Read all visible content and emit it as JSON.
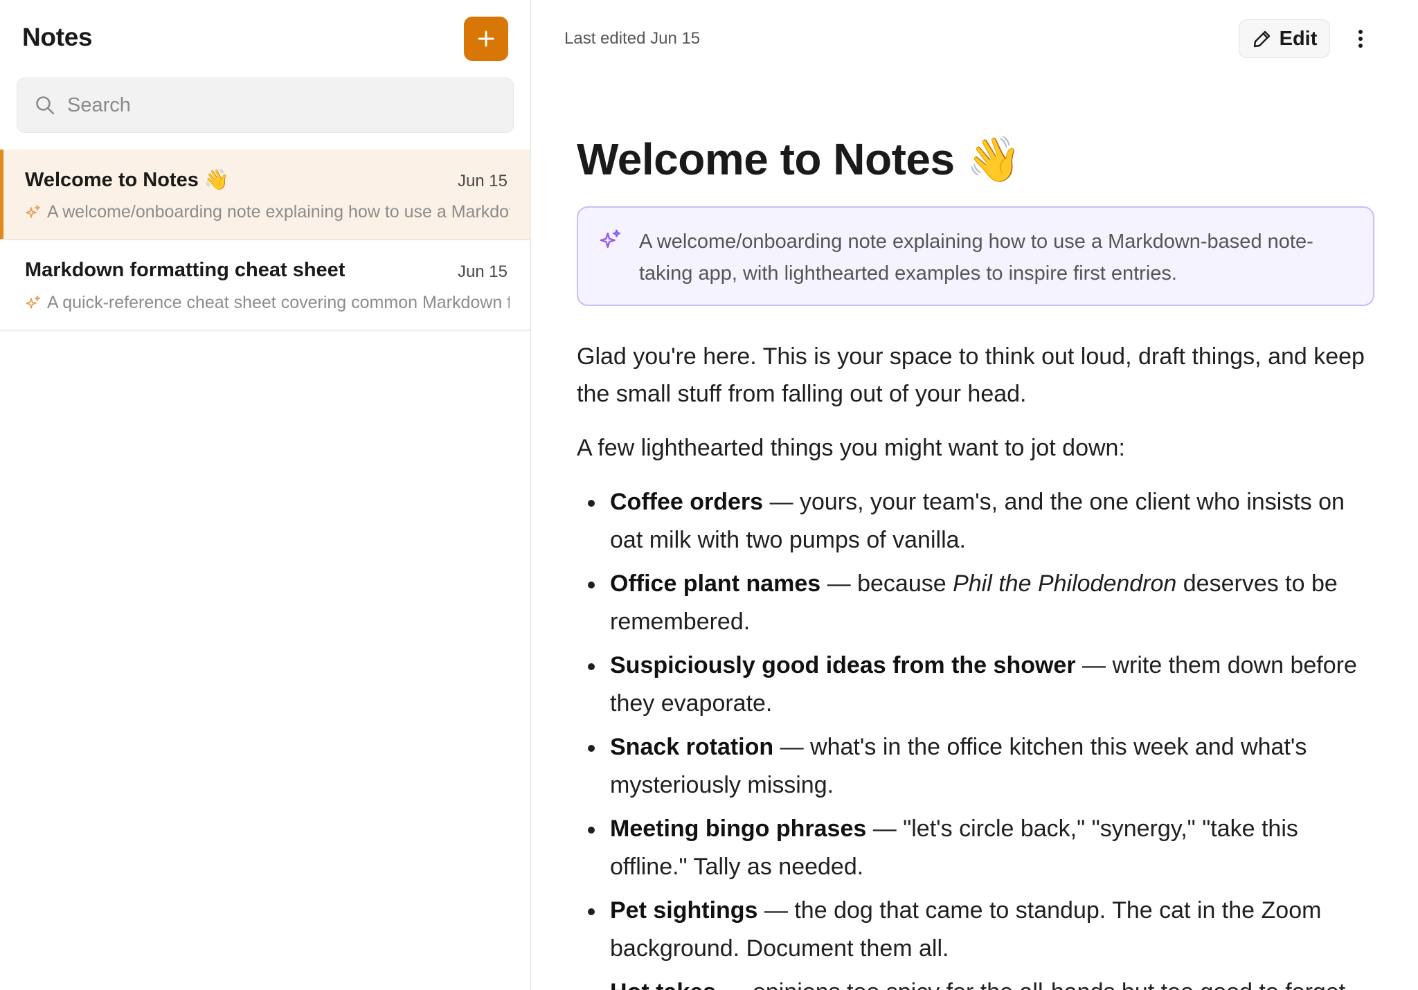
{
  "sidebar": {
    "title": "Notes",
    "search_placeholder": "Search",
    "notes": [
      {
        "title": "Welcome to Notes 👋",
        "date": "Jun 15",
        "summary": "A welcome/onboarding note explaining how to use a Markdown-based note-taking app, with lighthearted examples to inspire first entries.",
        "active": true
      },
      {
        "title": "Markdown formatting cheat sheet",
        "date": "Jun 15",
        "summary": "A quick-reference cheat sheet covering common Markdown formatting syntax.",
        "active": false
      }
    ]
  },
  "header": {
    "last_edited": "Last edited Jun 15",
    "edit_label": "Edit"
  },
  "document": {
    "title": "Welcome to Notes 👋",
    "summary": "A welcome/onboarding note explaining how to use a Markdown-based note-taking app, with lighthearted examples to inspire first entries.",
    "intro": "Glad you're here. This is your space to think out loud, draft things, and keep the small stuff from falling out of your head.",
    "list_lead": "A few lighthearted things you might want to jot down:",
    "items": [
      {
        "bold": "Coffee orders",
        "text": " — yours, your team's, and the one client who insists on oat milk with two pumps of vanilla."
      },
      {
        "bold": "Office plant names",
        "pre": " — because ",
        "italic": "Phil the Philodendron",
        "text": " deserves to be remembered."
      },
      {
        "bold": "Suspiciously good ideas from the shower",
        "text": " — write them down before they evaporate."
      },
      {
        "bold": "Snack rotation",
        "text": " — what's in the office kitchen this week and what's mysteriously missing."
      },
      {
        "bold": "Meeting bingo phrases",
        "text": " — \"let's circle back,\" \"synergy,\" \"take this offline.\" Tally as needed."
      },
      {
        "bold": "Pet sightings",
        "text": " — the dog that came to standup. The cat in the Zoom background. Document them all."
      },
      {
        "bold": "Hot takes",
        "text": " — opinions too spicy for the all-hands but too good to forget."
      }
    ]
  },
  "colors": {
    "accent": "#d97706",
    "active_row": "#fbf1e6",
    "summary_bg": "#f5f3ff",
    "summary_border": "#c9bdf5",
    "sparkle_purple": "#8b5cf6",
    "sparkle_orange": "#e8a25c"
  },
  "icons": [
    "plus-icon",
    "search-icon",
    "sparkle-icon",
    "pencil-icon",
    "more-vertical-icon"
  ]
}
